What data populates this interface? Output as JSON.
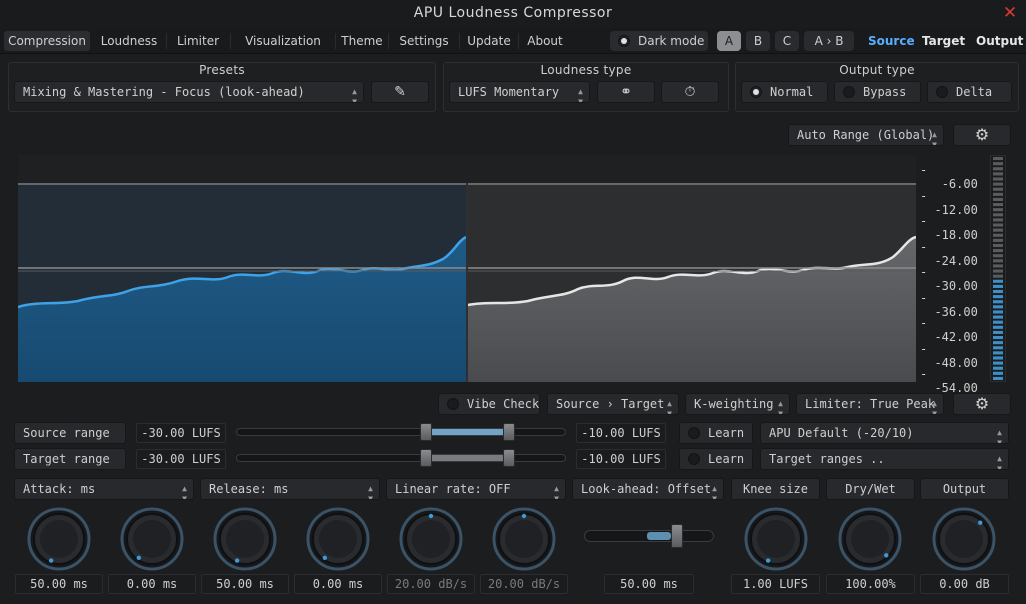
{
  "app": {
    "title": "APU Loudness Compressor"
  },
  "tabs": [
    "Compression",
    "Loudness",
    "Limiter",
    "Visualization",
    "Theme",
    "Settings",
    "Update",
    "About"
  ],
  "dark_mode": {
    "label": "Dark mode",
    "checked": true
  },
  "ab": {
    "a": "A",
    "b": "B",
    "c": "C",
    "atob": "A › B",
    "selected": "A"
  },
  "routing": {
    "source": "Source",
    "target": "Target",
    "output": "Output",
    "source_color": "#5aaeff"
  },
  "presets": {
    "label": "Presets",
    "value": "Mixing & Mastering - Focus (look-ahead)",
    "edit_icon": "pencil-icon"
  },
  "loudness_type": {
    "label": "Loudness type",
    "value": "LUFS Momentary",
    "link_icon": "link-icon",
    "timer_icon": "stopwatch-icon"
  },
  "output_type": {
    "label": "Output type",
    "options": [
      "Normal",
      "Bypass",
      "Delta"
    ],
    "selected": "Normal"
  },
  "auto_range": {
    "value": "Auto Range (Global)",
    "settings_icon": "gear-icon"
  },
  "scale": {
    "ticks": [
      "-6.00",
      "-12.00",
      "-18.00",
      "-24.00",
      "-30.00",
      "-36.00",
      "-42.00",
      "-48.00",
      "-54.00"
    ]
  },
  "bottom_toolbar": {
    "vibe_check": "Vibe Check",
    "route": "Source › Target",
    "weighting": "K-weighting",
    "limiter": "Limiter: True Peak",
    "settings_icon": "gear-icon"
  },
  "ranges": {
    "source": {
      "label": "Source range",
      "low": "-30.00 LUFS",
      "high": "-10.00 LUFS",
      "learn": "Learn",
      "preset": "APU Default (-20/10)",
      "low_frac": 0.58,
      "high_frac": 0.84
    },
    "target": {
      "label": "Target range",
      "low": "-30.00 LUFS",
      "high": "-10.00 LUFS",
      "learn": "Learn",
      "preset": "Target ranges ..",
      "low_frac": 0.58,
      "high_frac": 0.84
    }
  },
  "dynamics": {
    "attack": {
      "label": "Attack: ms"
    },
    "release": {
      "label": "Release: ms"
    },
    "linear_rate": {
      "label": "Linear rate: OFF"
    },
    "look_ahead": {
      "label": "Look-ahead: Offset",
      "value": "50.00 ms",
      "slider_frac": 0.74
    },
    "knee": {
      "label": "Knee size",
      "value": "1.00 LUFS"
    },
    "drywet": {
      "label": "Dry/Wet",
      "value": "100.00%"
    },
    "output": {
      "label": "Output",
      "value": "0.00 dB"
    }
  },
  "knob_values": [
    "50.00 ms",
    "0.00 ms",
    "50.00 ms",
    "0.00 ms",
    "20.00 dB/s",
    "20.00 dB/s"
  ],
  "colors": {
    "accent": "#3d9ad9",
    "source_fill": "#205a84",
    "target_fill": "#5c5d60",
    "close": "#d9392e"
  }
}
